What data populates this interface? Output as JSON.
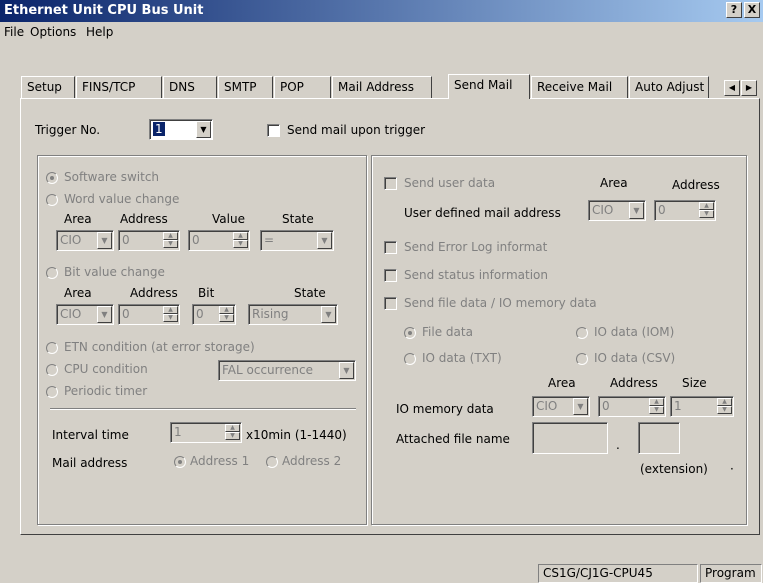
{
  "window": {
    "title": "Ethernet Unit CPU Bus Unit",
    "help_btn": "?",
    "close_btn": "X"
  },
  "menu": [
    "File",
    "Options",
    "Help"
  ],
  "tabs": [
    "Setup",
    "FINS/TCP",
    "DNS",
    "SMTP",
    "POP",
    "Mail Address",
    "Send Mail",
    "Receive Mail",
    "Auto Adjust"
  ],
  "active_tab": "Send Mail",
  "trigger": {
    "label": "Trigger No.",
    "value": "1",
    "send_upon_trigger_label": "Send mail upon trigger"
  },
  "left": {
    "software_switch": "Software switch",
    "word_value_change": "Word value change",
    "word_headers": {
      "area": "Area",
      "address": "Address",
      "value": "Value",
      "state": "State"
    },
    "word_area": "CIO",
    "word_address": "0",
    "word_value": "0",
    "word_state": "=",
    "bit_value_change": "Bit value change",
    "bit_headers": {
      "area": "Area",
      "address": "Address",
      "bit": "Bit",
      "state": "State"
    },
    "bit_area": "CIO",
    "bit_address": "0",
    "bit_bit": "0",
    "bit_state": "Rising",
    "etn_condition": "ETN condition (at error storage)",
    "cpu_condition": "CPU condition",
    "cpu_condition_value": "FAL occurrence",
    "periodic_timer": "Periodic timer",
    "interval_label": "Interval time",
    "interval_value": "1",
    "interval_unit": "x10min (1-1440)",
    "mail_address_label": "Mail address",
    "address1": "Address 1",
    "address2": "Address 2"
  },
  "right": {
    "send_user_data": "Send user data",
    "area_header": "Area",
    "address_header": "Address",
    "user_defined_label": "User defined mail address",
    "user_area": "CIO",
    "user_address": "0",
    "send_error_log": "Send Error Log informat",
    "send_status": "Send status information",
    "send_file_data": "Send file data / IO memory data",
    "file_data": "File data",
    "io_data_iom": "IO data (IOM)",
    "io_data_txt": "IO data (TXT)",
    "io_data_csv": "IO data (CSV)",
    "io_area_header": "Area",
    "io_address_header": "Address",
    "io_size_header": "Size",
    "io_memory_label": "IO memory data",
    "io_area": "CIO",
    "io_address": "0",
    "io_size": "1",
    "attached_label": "Attached file name",
    "dot": ".",
    "extension_label": "(extension)",
    "extension_dot": "·"
  },
  "status": {
    "model": "CS1G/CJ1G-CPU45",
    "mode": "Program"
  }
}
